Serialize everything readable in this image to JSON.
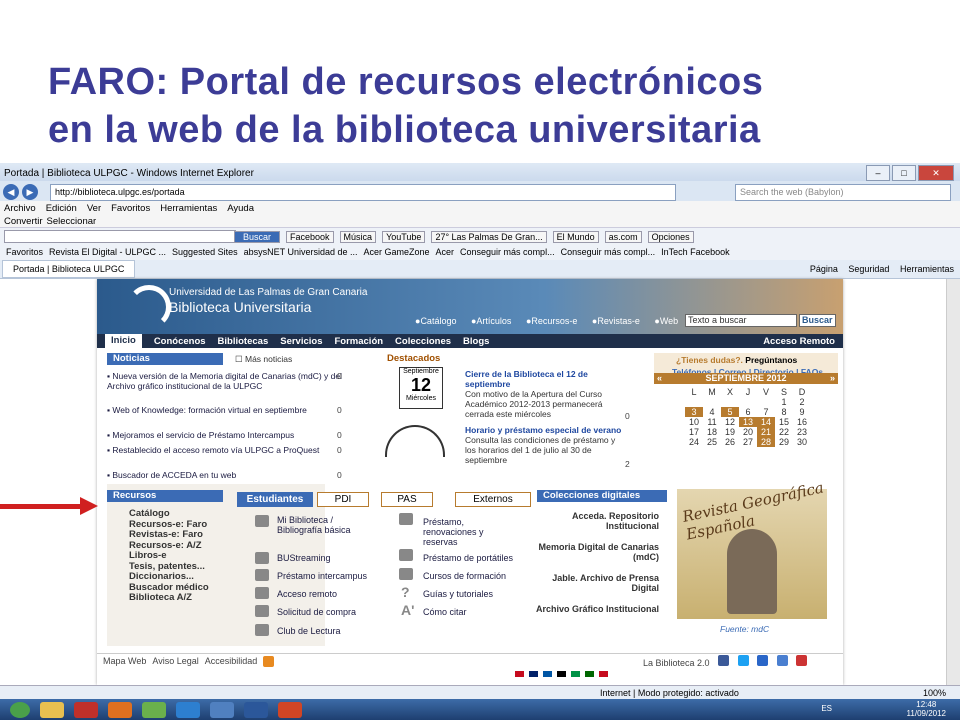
{
  "slide": {
    "title_line1": "FARO: Portal de recursos electrónicos",
    "title_line2": "en la web de la biblioteca universitaria"
  },
  "browser": {
    "window_title": "Portada | Biblioteca ULPGC - Windows Internet Explorer",
    "address": "http://biblioteca.ulpgc.es/portada",
    "search_placeholder": "Search the web (Babylon)",
    "menu": [
      "Archivo",
      "Edición",
      "Ver",
      "Favoritos",
      "Herramientas",
      "Ayuda"
    ],
    "cmd": {
      "convertir": "Convertir",
      "seleccionar": "Seleccionar"
    },
    "toolbar": {
      "buscar": "Buscar",
      "facebook": "Facebook",
      "musica": "Música",
      "youtube": "YouTube",
      "weather": "27° Las Palmas De Gran...",
      "elmundo": "El Mundo",
      "ascom": "as.com",
      "opciones": "Opciones"
    },
    "favorites": {
      "label": "Favoritos",
      "items": [
        "Revista El Digital - ULPGC ...",
        "Suggested Sites",
        "absysNET Universidad de ...",
        "Acer GameZone",
        "Acer",
        "Conseguir más compl...",
        "Conseguir más compl...",
        "InTech Facebook"
      ]
    },
    "tab": "Portada | Biblioteca ULPGC",
    "cmdright": [
      "Página",
      "Seguridad",
      "Herramientas"
    ],
    "status": {
      "text": "Internet | Modo protegido: activado",
      "zoom": "100%"
    },
    "taskbar": {
      "lang": "ES",
      "time": "12:48",
      "date": "11/09/2012"
    }
  },
  "site": {
    "university": "Universidad de Las Palmas de Gran Canaria",
    "library": "Biblioteca Universitaria",
    "quick": [
      "Catálogo",
      "Artículos",
      "Recursos-e",
      "Revistas-e",
      "Web"
    ],
    "search_value": "Texto a buscar",
    "search_btn": "Buscar",
    "nav": [
      "Inicio",
      "Conócenos",
      "Bibliotecas",
      "Servicios",
      "Formación",
      "Colecciones",
      "Blogs"
    ],
    "remote": "Acceso Remoto",
    "news": {
      "title": "Noticias",
      "more": "Más noticias",
      "items": [
        {
          "text": "Nueva versión de la Memoria digital de Canarias (mdC) y del Archivo gráfico institucional de la ULPGC",
          "count": "0"
        },
        {
          "text": "Web of Knowledge: formación virtual en septiembre",
          "count": "0"
        },
        {
          "text": "Mejoramos el servicio de Préstamo Intercampus",
          "count": "0"
        },
        {
          "text": "Restablecido el acceso remoto vía ULPGC a ProQuest",
          "count": "0"
        },
        {
          "text": "Buscador de ACCEDA en tu web",
          "count": "0"
        }
      ]
    },
    "featured": {
      "title": "Destacados",
      "item1_title": "Cierre de la Biblioteca el 12 de septiembre",
      "item1_text": "Con motivo de la Apertura del Curso Académico 2012-2013 permanecerá cerrada este miércoles",
      "item1_count": "0",
      "cal_day": "12",
      "cal_month": "Septiembre",
      "cal_weekday": "Miércoles",
      "item2_title": "Horario y préstamo especial de verano",
      "item2_text": "Consulta las condiciones de préstamo y los horarios del 1 de julio al 30 de septiembre",
      "item2_count": "2"
    },
    "help": {
      "question": "¿Tienes dudas?.",
      "ask": "Pregúntanos",
      "links": "Teléfonos | Correo | Directorio | FAQs"
    },
    "calendar": {
      "month": "SEPTIEMBRE 2012",
      "prev": "«",
      "next": "»",
      "weekdays": [
        "L",
        "M",
        "X",
        "J",
        "V",
        "S",
        "D"
      ],
      "rows": [
        [
          "",
          "",
          "",
          "",
          "",
          "1",
          "2"
        ],
        [
          "3",
          "4",
          "5",
          "6",
          "7",
          "8",
          "9"
        ],
        [
          "10",
          "11",
          "12",
          "13",
          "14",
          "15",
          "16"
        ],
        [
          "17",
          "18",
          "19",
          "20",
          "21",
          "22",
          "23"
        ],
        [
          "24",
          "25",
          "26",
          "27",
          "28",
          "29",
          "30"
        ]
      ]
    },
    "resources": {
      "title": "Recursos",
      "items": [
        "Catálogo",
        "Recursos-e: Faro",
        "Revistas-e: Faro",
        "Recursos-e: A/Z",
        "Libros-e",
        "Tesis, patentes...",
        "Diccionarios...",
        "Buscador médico",
        "Biblioteca A/Z"
      ]
    },
    "tabs": [
      "Estudiantes",
      "PDI",
      "PAS",
      "Externos"
    ],
    "services_left": [
      "Mi Biblioteca / Bibliografía básica",
      "BUStreaming",
      "Préstamo intercampus",
      "Acceso remoto",
      "Solicitud de compra",
      "Club de Lectura"
    ],
    "services_right": [
      "Préstamo, renovaciones y reservas",
      "Préstamo de portátiles",
      "Cursos de formación",
      "Guías y tutoriales",
      "Cómo citar"
    ],
    "collections": {
      "title": "Colecciones digitales",
      "items": [
        "Acceda. Repositorio Institucional",
        "Memoria Digital de Canarias (mdC)",
        "Jable. Archivo de Prensa Digital",
        "Archivo Gráfico Institucional"
      ]
    },
    "poster_text": "Revista Geográfica Española",
    "source": "Fuente: mdC",
    "footer": [
      "Mapa Web",
      "Aviso Legal",
      "Accesibilidad"
    ],
    "footer_right": "La Biblioteca 2.0"
  }
}
